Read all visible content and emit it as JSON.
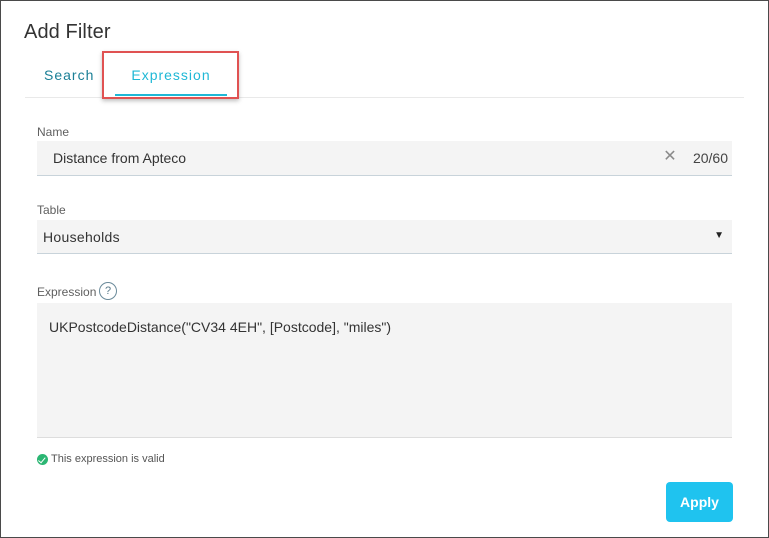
{
  "dialog": {
    "title": "Add Filter"
  },
  "tabs": [
    {
      "label": "Search",
      "active": false
    },
    {
      "label": "Expression",
      "active": true
    }
  ],
  "name_field": {
    "label": "Name",
    "value": "Distance from Apteco",
    "char_count": "20/60",
    "clear_icon": "close-icon"
  },
  "table_field": {
    "label": "Table",
    "selected": "Households",
    "dropdown_icon": "caret-down-icon"
  },
  "expression_field": {
    "label": "Expression",
    "help_icon": "question-circle-icon",
    "help_glyph": "?",
    "value": "UKPostcodeDistance(\"CV34 4EH\", [Postcode], \"miles\")"
  },
  "validation": {
    "icon": "check-circle-icon",
    "message": "This expression is valid"
  },
  "actions": {
    "apply_label": "Apply"
  },
  "colors": {
    "accent": "#1fb8d6",
    "apply_button": "#1fc3ef",
    "valid": "#2bb673",
    "highlight": "#e05252"
  }
}
